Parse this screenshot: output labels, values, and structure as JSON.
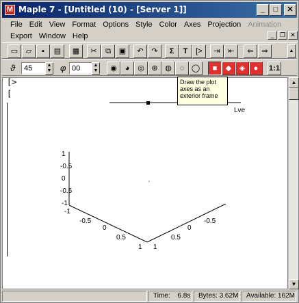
{
  "window": {
    "title": "Maple 7 - [Untitled (10) - [Server 1]]",
    "app_icon_glyph": "M",
    "controls": {
      "minimize": "_",
      "maximize": "□",
      "close": "✕"
    }
  },
  "menu": {
    "row1": [
      "File",
      "Edit",
      "View",
      "Format",
      "Options",
      "Style",
      "Color",
      "Axes",
      "Projection",
      "Animation"
    ],
    "row2": [
      "Export",
      "Window",
      "Help"
    ]
  },
  "toolbar1": {
    "icons": [
      "new-icon",
      "open-icon",
      "save-icon",
      "print-icon",
      "cut-icon",
      "copy-icon",
      "paste-icon",
      "undo-icon",
      "redo-icon",
      "sigma-icon",
      "text-icon",
      "prompt-icon",
      "indent-icon",
      "outdent-icon",
      "back-icon",
      "forward-icon"
    ],
    "labels": {
      "sigma": "Σ",
      "text": "T",
      "prompt": "[>"
    }
  },
  "toolbar2": {
    "theta_label": "ϑ",
    "theta_value": "45",
    "phi_label": "φ",
    "phi_value": "00",
    "constrained_label": "1:1"
  },
  "worksheet": {
    "prompt": "[>",
    "bracket2": "[",
    "bracket3": "["
  },
  "tooltip": {
    "line1": "Draw the plot",
    "line2": "axes as an",
    "line3": "exterior frame"
  },
  "plot": {
    "legend_label": "Lve",
    "z_ticks": [
      "1",
      "-0.5",
      "0",
      "-0.5",
      "-1"
    ],
    "x_ticks": [
      "-1",
      "-0.5",
      "0",
      "0.5",
      "1"
    ],
    "y_ticks": [
      "1",
      "0.5",
      "0",
      "-0.5"
    ]
  },
  "status": {
    "time_label": "Time:",
    "time_value": "6.8s",
    "bytes_label": "Bytes:",
    "bytes_value": "3.62M",
    "available_label": "Available:",
    "available_value": "162M"
  }
}
